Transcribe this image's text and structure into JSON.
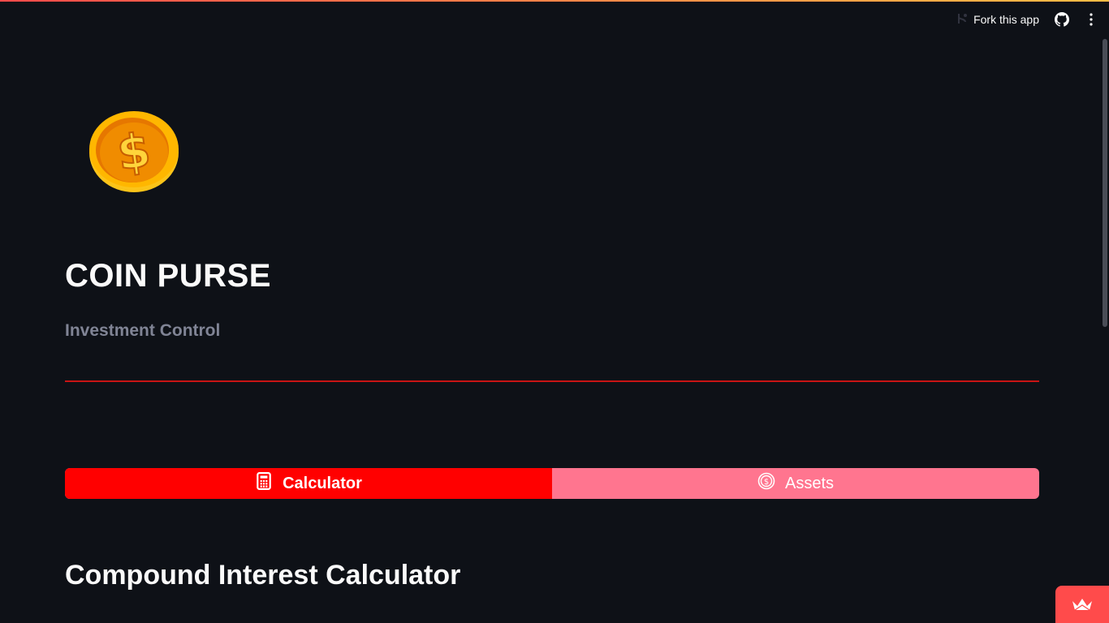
{
  "colors": {
    "background": "#0e1117",
    "accent": "#ff4b4b",
    "divider": "#c81414",
    "tab_active": "#ff0000",
    "tab_inactive": "#ff758f"
  },
  "toolbar": {
    "fork_label": "Fork this app",
    "fork_icon": "fork-icon",
    "github_icon": "github-icon",
    "menu_icon": "kebab-menu-icon"
  },
  "app": {
    "logo_icon": "coin-dollar-icon",
    "title": "COIN PURSE",
    "subtitle": "Investment Control"
  },
  "tabs": [
    {
      "label": "Calculator",
      "icon": "calculator-icon",
      "selected": true
    },
    {
      "label": "Assets",
      "icon": "coin-icon",
      "selected": false
    }
  ],
  "section": {
    "title": "Compound Interest Calculator"
  },
  "badge": {
    "icon": "streamlit-crown-icon"
  }
}
